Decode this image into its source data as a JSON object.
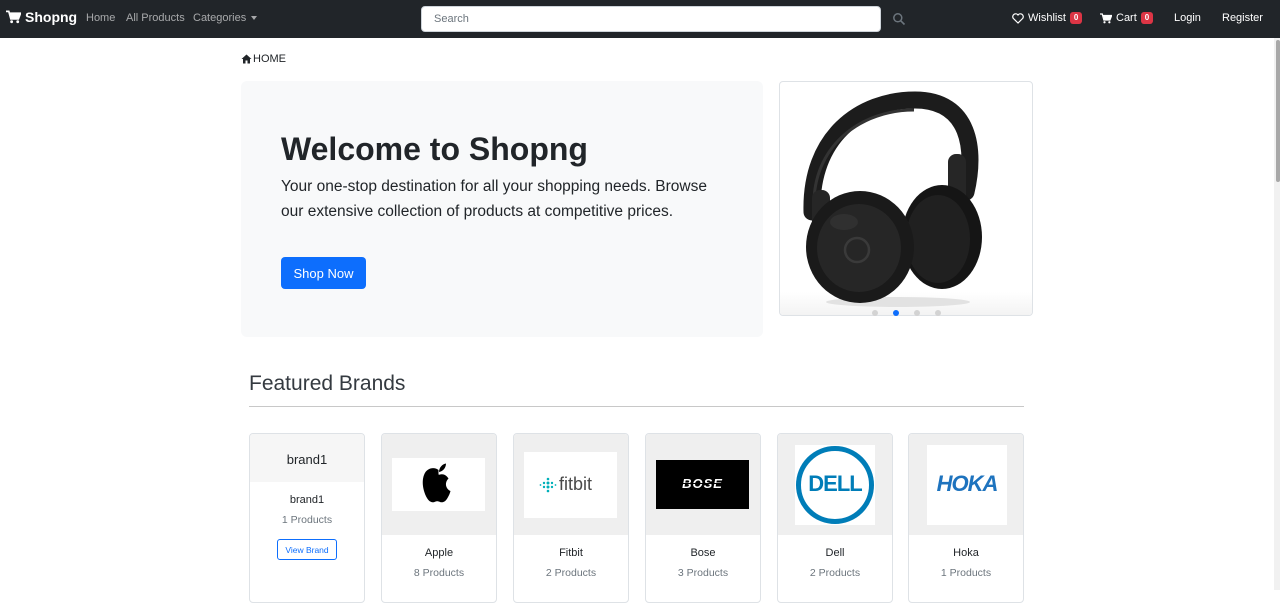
{
  "navbar": {
    "brand": "Shopng",
    "links": {
      "home": "Home",
      "all_products": "All Products",
      "categories": "Categories"
    },
    "search_placeholder": "Search",
    "wishlist": {
      "label": "Wishlist",
      "count": "0"
    },
    "cart": {
      "label": "Cart",
      "count": "0"
    },
    "login": "Login",
    "register": "Register"
  },
  "breadcrumb": {
    "home": "HOME"
  },
  "hero": {
    "title": "Welcome to Shopng",
    "text": "Your one-stop destination for all your shopping needs. Browse our extensive collection of products at competitive prices.",
    "button": "Shop Now"
  },
  "carousel": {
    "slide_count": 4,
    "active_index": 1,
    "image": "headphones"
  },
  "featured": {
    "title": "Featured Brands",
    "brands": [
      {
        "logo_text": "brand1",
        "name": "brand1",
        "count": "1 Products",
        "button": "View Brand"
      },
      {
        "logo": "apple-logo",
        "name": "Apple",
        "count": "8 Products"
      },
      {
        "logo_text": "fitbit",
        "name": "Fitbit",
        "count": "2 Products"
      },
      {
        "logo_text": "BOSE",
        "name": "Bose",
        "count": "3 Products"
      },
      {
        "logo_text": "DELL",
        "name": "Dell",
        "count": "2 Products"
      },
      {
        "logo_text": "HOKA",
        "name": "Hoka",
        "count": "1 Products"
      }
    ]
  },
  "colors": {
    "navbar": "#212529",
    "primary": "#0d6efd",
    "badge": "#dc3545",
    "hero_bg": "#f8f9fa",
    "dell_blue": "#007db8",
    "hoka_blue": "#1e73be"
  }
}
